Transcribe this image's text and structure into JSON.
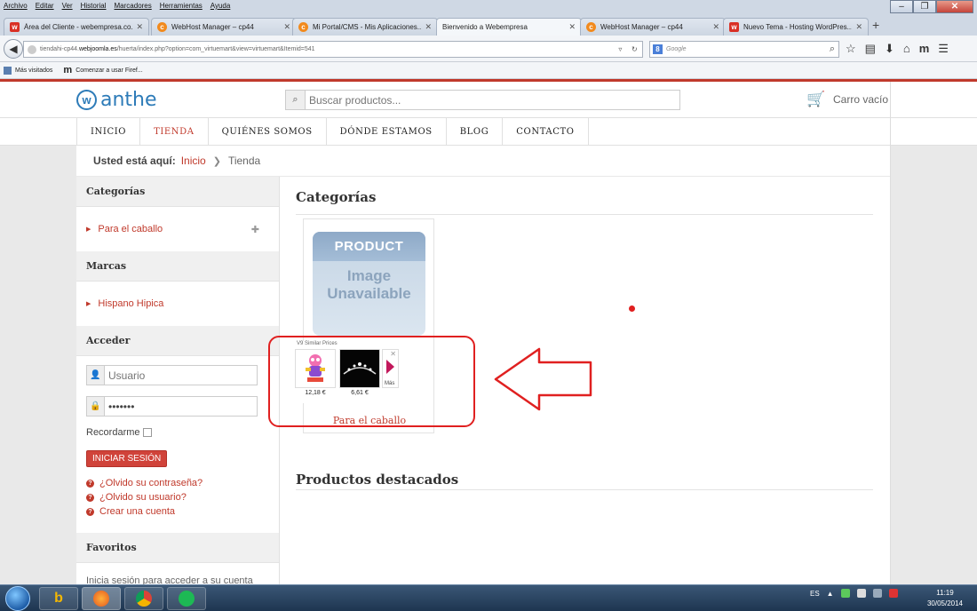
{
  "browser": {
    "menu": [
      "Archivo",
      "Editar",
      "Ver",
      "Historial",
      "Marcadores",
      "Herramientas",
      "Ayuda"
    ],
    "tabs": [
      {
        "label": "Área del Cliente - webempresa.co...",
        "icon": "w",
        "active": false
      },
      {
        "label": "WebHost Manager – cp44",
        "icon": "cP",
        "active": false
      },
      {
        "label": "Mi Portal/CMS - Mis Aplicaciones...",
        "icon": "cP",
        "active": false
      },
      {
        "label": "Bienvenido a Webempresa",
        "icon": "",
        "active": true
      },
      {
        "label": "WebHost Manager – cp44",
        "icon": "cP",
        "active": false
      },
      {
        "label": "Nuevo Tema - Hosting WordPres...",
        "icon": "w",
        "active": false
      }
    ],
    "url_domain_prefix": "tiendahi-cp44.",
    "url_domain": "webjoomla.es",
    "url_path": "/huerta/index.php?option=com_virtuemart&view=virtuemart&Itemid=541",
    "search_placeholder": "Google",
    "bookmarks": [
      "Más visitados",
      "Comenzar a usar Firef..."
    ]
  },
  "site": {
    "logo_text": "anthe",
    "search_placeholder": "Buscar productos...",
    "cart_label": "Carro vacío",
    "nav": [
      {
        "label": "INICIO",
        "active": false
      },
      {
        "label": "TIENDA",
        "active": true
      },
      {
        "label": "QUIÉNES SOMOS",
        "active": false
      },
      {
        "label": "DÓNDE ESTAMOS",
        "active": false
      },
      {
        "label": "BLOG",
        "active": false
      },
      {
        "label": "CONTACTO",
        "active": false
      }
    ],
    "breadcrumb": {
      "label": "Usted está aquí:",
      "home": "Inicio",
      "current": "Tienda"
    }
  },
  "sidebar": {
    "categories_title": "Categorías",
    "categories": [
      "Para el caballo"
    ],
    "brands_title": "Marcas",
    "brands": [
      "Hispano Hipica"
    ],
    "login_title": "Acceder",
    "username_placeholder": "Usuario",
    "password_value": "•••••••",
    "remember_label": "Recordarme",
    "login_button": "INICIAR SESIÓN",
    "links": [
      "¿Olvido su contraseña?",
      "¿Olvido su usuario?",
      "Crear una cuenta"
    ],
    "favorites_title": "Favoritos",
    "favorites_text": "Inicia sesión para acceder a su cuenta"
  },
  "content": {
    "categories_heading": "Categorías",
    "category_name": "Para el caballo",
    "no_image_top": "PRODUCT",
    "no_image_line1": "Image",
    "no_image_line2": "Unavailable",
    "similar_title": "V9 Similar Prices",
    "similar_prices": [
      "12,18 €",
      "6,61 €"
    ],
    "similar_more": "Más",
    "featured_heading": "Productos destacados"
  },
  "taskbar": {
    "lang": "ES",
    "time": "11:19",
    "date": "30/05/2014"
  },
  "colors": {
    "accent": "#c0392b",
    "brand_blue": "#2d7bb8",
    "annotation": "#e02020"
  }
}
